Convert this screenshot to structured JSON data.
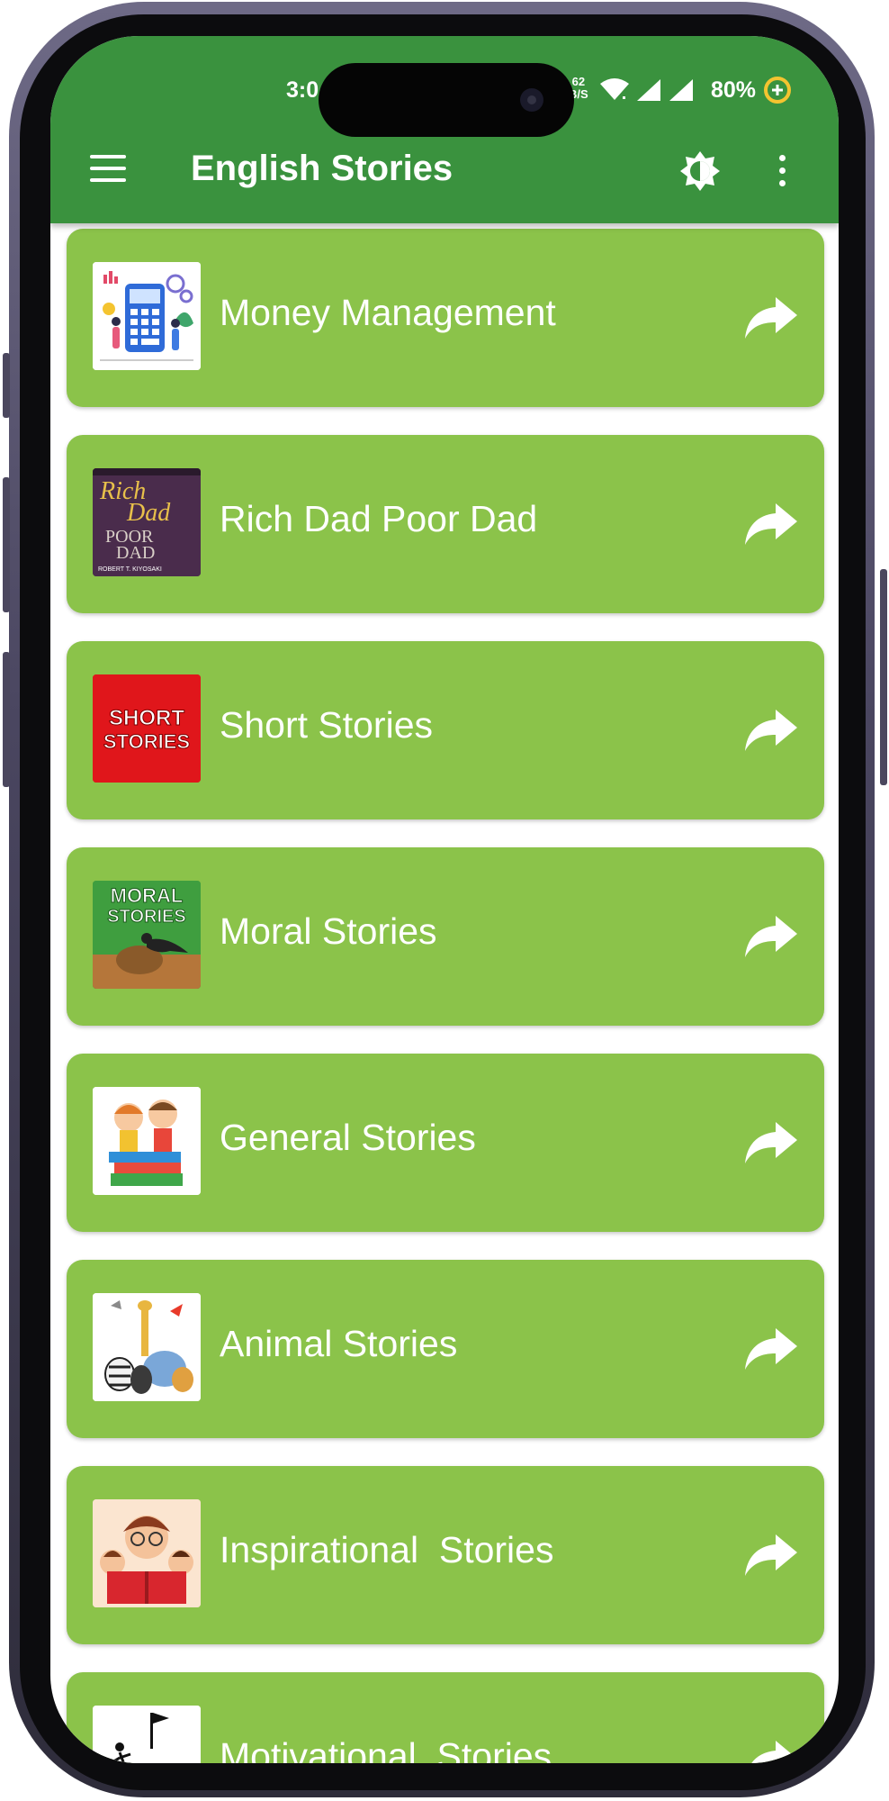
{
  "status_bar": {
    "time": "3:0",
    "net_speed_top": "62",
    "net_speed_bottom": "B/S",
    "battery": "80%"
  },
  "toolbar": {
    "title": "English Stories",
    "menu_icon": "hamburger-menu-icon",
    "theme_icon": "brightness-icon",
    "more_icon": "more-vert-icon"
  },
  "colors": {
    "appbar": "#3a923e",
    "card": "#8bc34a",
    "text": "#ffffff"
  },
  "stories": [
    {
      "label": "Money Management",
      "thumb": "money-management-thumbnail"
    },
    {
      "label": "Rich Dad Poor Dad",
      "thumb": "rich-dad-poor-dad-cover"
    },
    {
      "label": "Short Stories",
      "thumb": "short-stories-logo",
      "thumb_text": [
        "SHORT",
        "STORIES"
      ]
    },
    {
      "label": "Moral Stories",
      "thumb": "moral-stories-cover",
      "thumb_text": [
        "MORAL",
        "STORIES"
      ]
    },
    {
      "label": "General Stories",
      "thumb": "general-stories-kids-illustration"
    },
    {
      "label": "Animal Stories",
      "thumb": "animal-stories-illustration"
    },
    {
      "label": "Inspirational  Stories",
      "thumb": "inspirational-stories-illustration"
    },
    {
      "label": "Motivational  Stories",
      "thumb": "motivational-stories-thumbnail"
    }
  ],
  "rich_dad_cover_text": [
    "Rich",
    "Dad",
    "POOR",
    "DAD",
    "ROBERT T. KIYOSAKI"
  ]
}
